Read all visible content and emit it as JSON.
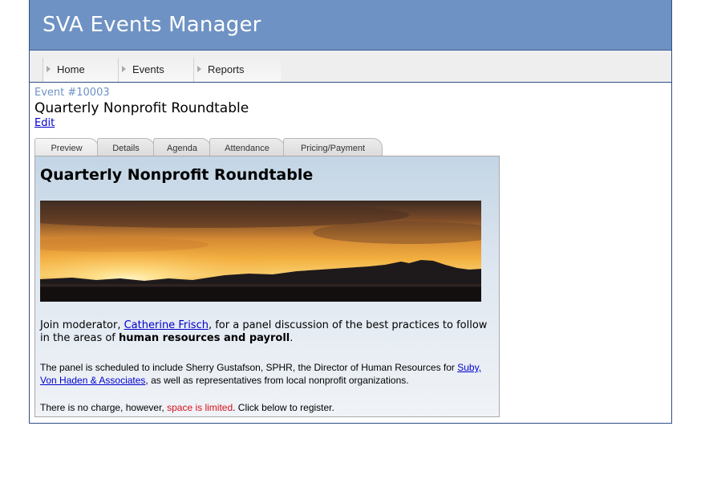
{
  "app": {
    "title": "SVA Events Manager"
  },
  "nav": {
    "items": [
      {
        "label": "Home"
      },
      {
        "label": "Events"
      },
      {
        "label": "Reports"
      }
    ]
  },
  "event": {
    "number": "Event #10003",
    "title": "Quarterly Nonprofit Roundtable",
    "edit_label": "Edit"
  },
  "tabs": [
    {
      "label": "Preview",
      "active": true
    },
    {
      "label": "Details"
    },
    {
      "label": "Agenda"
    },
    {
      "label": "Attendance"
    },
    {
      "label": "Pricing/Payment"
    }
  ],
  "preview": {
    "heading": "Quarterly Nonprofit Roundtable",
    "intro": {
      "pre": "Join moderator, ",
      "moderator_link": "Catherine Frisch",
      "mid": ", for a panel discussion of the best practices to follow in the areas of ",
      "bold": "human resources and payroll",
      "post": "."
    },
    "panel": {
      "pre": "The panel is scheduled to include Sherry Gustafson, SPHR, the Director of Human Resources for ",
      "company_link": "Suby, Von Haden & Associates",
      "post": ", as well as representatives from local nonprofit organizations."
    },
    "charge": {
      "pre": "There is no charge, however, ",
      "highlight": "space is limited",
      "post": ". Click below to register."
    }
  },
  "colors": {
    "header_bg": "#6e92c3",
    "border": "#2e4f86",
    "link": "#0000cc",
    "alert": "#d8101c"
  }
}
